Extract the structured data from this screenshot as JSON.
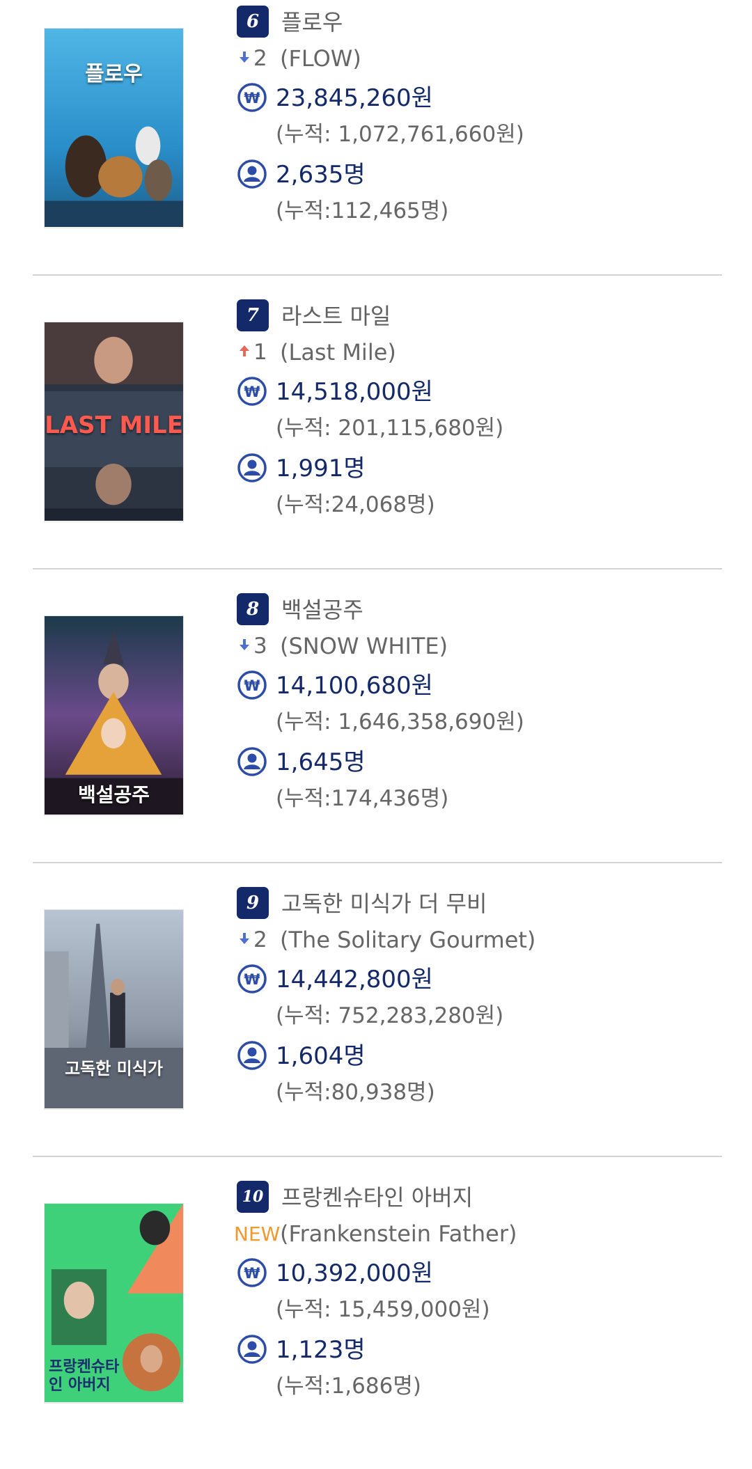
{
  "colors": {
    "rank_bg": "#13296a",
    "accent_blue": "#13296a",
    "down": "#4d6fd1",
    "up": "#e8665a",
    "new": "#f1992f",
    "divider": "#d2d2d7"
  },
  "movies": [
    {
      "rank": "6",
      "title": "플로우",
      "change_dir": "down",
      "change_icon": "down-arrow-icon",
      "change": "2",
      "english_title": "(FLOW)",
      "sales": "23,845,260원",
      "sales_acc": "(누적: 1,072,761,660원)",
      "audience": "2,635명",
      "audience_acc": "(누적:112,465명)",
      "poster_text": "플로우"
    },
    {
      "rank": "7",
      "title": "라스트 마일",
      "change_dir": "up",
      "change_icon": "up-arrow-icon",
      "change": "1",
      "english_title": "(Last Mile)",
      "sales": "14,518,000원",
      "sales_acc": "(누적: 201,115,680원)",
      "audience": "1,991명",
      "audience_acc": "(누적:24,068명)",
      "poster_text": "LAST MILE"
    },
    {
      "rank": "8",
      "title": "백설공주",
      "change_dir": "down",
      "change_icon": "down-arrow-icon",
      "change": "3",
      "english_title": "(SNOW WHITE)",
      "sales": "14,100,680원",
      "sales_acc": "(누적: 1,646,358,690원)",
      "audience": "1,645명",
      "audience_acc": "(누적:174,436명)",
      "poster_text": "백설공주"
    },
    {
      "rank": "9",
      "title": "고독한 미식가 더 무비",
      "change_dir": "down",
      "change_icon": "down-arrow-icon",
      "change": "2",
      "english_title": "(The Solitary Gourmet)",
      "sales": "14,442,800원",
      "sales_acc": "(누적: 752,283,280원)",
      "audience": "1,604명",
      "audience_acc": "(누적:80,938명)",
      "poster_text": "고독한 미식가"
    },
    {
      "rank": "10",
      "title": "프랑켄슈타인 아버지",
      "change_dir": "new",
      "change": "NEW",
      "english_title": "(Frankenstein Father)",
      "sales": "10,392,000원",
      "sales_acc": "(누적: 15,459,000원)",
      "audience": "1,123명",
      "audience_acc": "(누적:1,686명)",
      "poster_text": "프랑켄슈타인 아버지"
    }
  ]
}
